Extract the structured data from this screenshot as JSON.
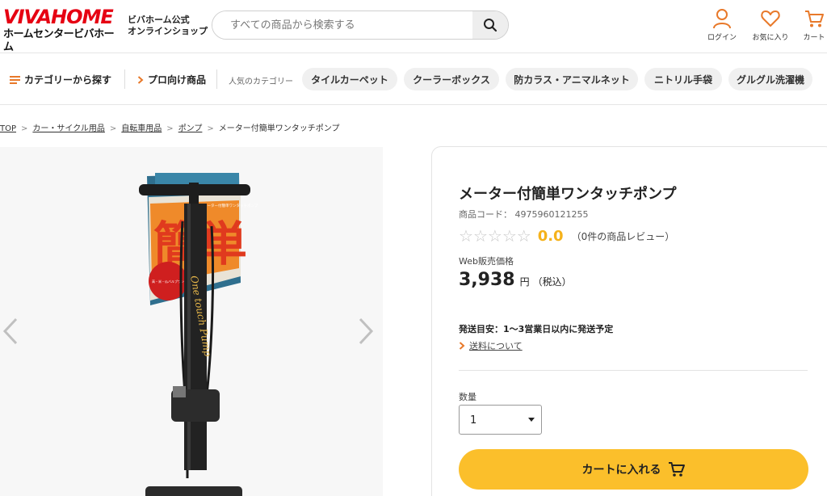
{
  "header": {
    "logo_top_a": "VIVA",
    "logo_top_b": "HOME",
    "logo_bottom": "ホームセンタービバホーム",
    "site_name_line1": "ビバホーム公式",
    "site_name_line2": "オンラインショップ",
    "search_placeholder": "すべての商品から検索する",
    "login_label": "ログイン",
    "favorites_label": "お気に入り",
    "cart_label": "カート",
    "accent_color": "#e8792a"
  },
  "nav": {
    "category_label": "カテゴリーから探す",
    "pro_label": "プロ向け商品",
    "popular_label": "人気のカテゴリー",
    "chips": [
      "タイルカーペット",
      "クーラーボックス",
      "防カラス・アニマルネット",
      "ニトリル手袋",
      "グルグル洗濯機"
    ]
  },
  "breadcrumb": {
    "items": [
      "TOP",
      "カー・サイクル用品",
      "自転車用品",
      "ポンプ"
    ],
    "current": "メーター付簡単ワンタッチポンプ"
  },
  "gallery": {
    "package_text_main": "簡単",
    "package_text_small": "メーター付簡単ワンタッチポンプ",
    "package_badge": "高・米・仏バルブワンタッチ切替付",
    "handle_text": "One touch Pump"
  },
  "product": {
    "title": "メーター付簡単ワンタッチポンプ",
    "code_label": "商品コード：",
    "code": "4975960121255",
    "score": "0.0",
    "review_text": "（0件の商品レビュー）",
    "price_label": "Web販売価格",
    "price": "3,938",
    "price_unit": "円",
    "price_tax": "（税込）",
    "shipping": "発送目安：1～3営業日以内に発送予定",
    "shipping_link": "送料について",
    "qty_label": "数量",
    "qty_value": "1",
    "cart_button": "カートに入れる",
    "rating_stars": 0,
    "cart_color": "#fbbf2b"
  }
}
